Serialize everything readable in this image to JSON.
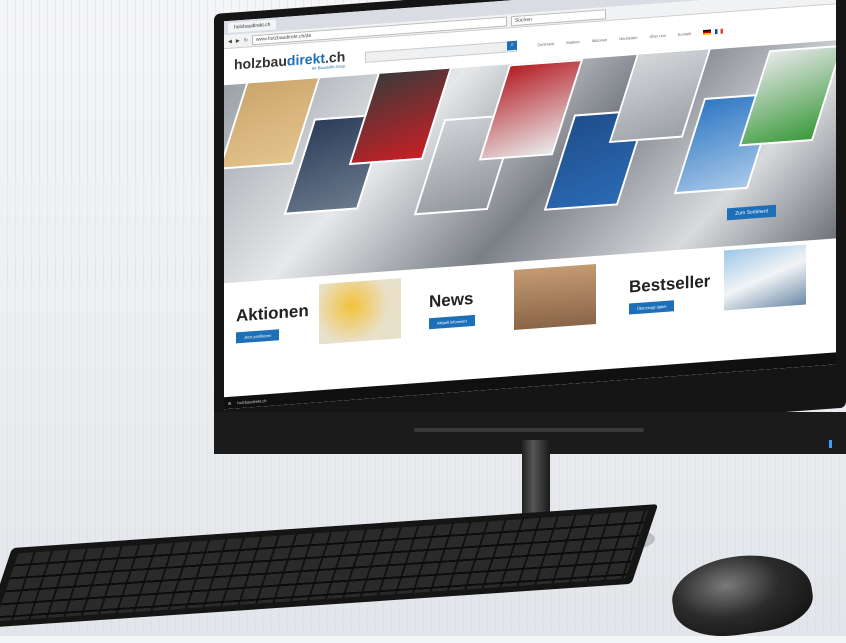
{
  "browser": {
    "tab_label": "holzbaudirekt.ch",
    "url": "www.holzbaudirekt.ch/de",
    "search_placeholder": "Suchen",
    "window_controls": [
      "–",
      "□",
      "×"
    ]
  },
  "site": {
    "logo_main": "holzbau",
    "logo_accent": "direkt",
    "logo_tld": ".ch",
    "tagline": "Ihr Baustoffe-Shop",
    "nav": [
      "Sortiment",
      "Marken",
      "Aktionen",
      "Neuheiten",
      "Über uns",
      "Kontakt"
    ],
    "hero_button": "Zum Sortiment"
  },
  "promos": [
    {
      "title": "Aktionen",
      "button": "Jetzt profitieren"
    },
    {
      "title": "News",
      "button": "Aktuell informiert"
    },
    {
      "title": "Bestseller",
      "button": "Überzeugt dabei"
    }
  ],
  "taskbar": {
    "app_label": "holzbaudirekt.ch"
  },
  "colors": {
    "brand_blue": "#1d6fb8",
    "dark": "#151515"
  }
}
